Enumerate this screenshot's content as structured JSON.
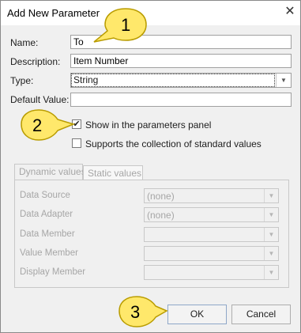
{
  "window": {
    "title": "Add New Parameter"
  },
  "form": {
    "name_label": "Name:",
    "name_value": "To",
    "description_label": "Description:",
    "description_value": "Item Number",
    "type_label": "Type:",
    "type_value": "String",
    "default_label": "Default Value:",
    "default_value": ""
  },
  "options": {
    "show_panel_label": "Show in the parameters panel",
    "show_panel_checked": true,
    "standard_values_label": "Supports the collection of standard values",
    "standard_values_checked": false
  },
  "tabs": [
    {
      "label": "Dynamic values",
      "active": true
    },
    {
      "label": "Static values",
      "active": false
    }
  ],
  "dynamic_fields": [
    {
      "label": "Data Source",
      "value": "(none)"
    },
    {
      "label": "Data Adapter",
      "value": "(none)"
    },
    {
      "label": "Data Member",
      "value": ""
    },
    {
      "label": "Value Member",
      "value": ""
    },
    {
      "label": "Display Member",
      "value": ""
    }
  ],
  "buttons": {
    "ok": "OK",
    "cancel": "Cancel"
  },
  "callouts": [
    "1",
    "2",
    "3"
  ],
  "colors": {
    "callout_fill": "#ffe86b",
    "callout_stroke": "#b99c00",
    "disabled_text": "#a6a6a6"
  }
}
